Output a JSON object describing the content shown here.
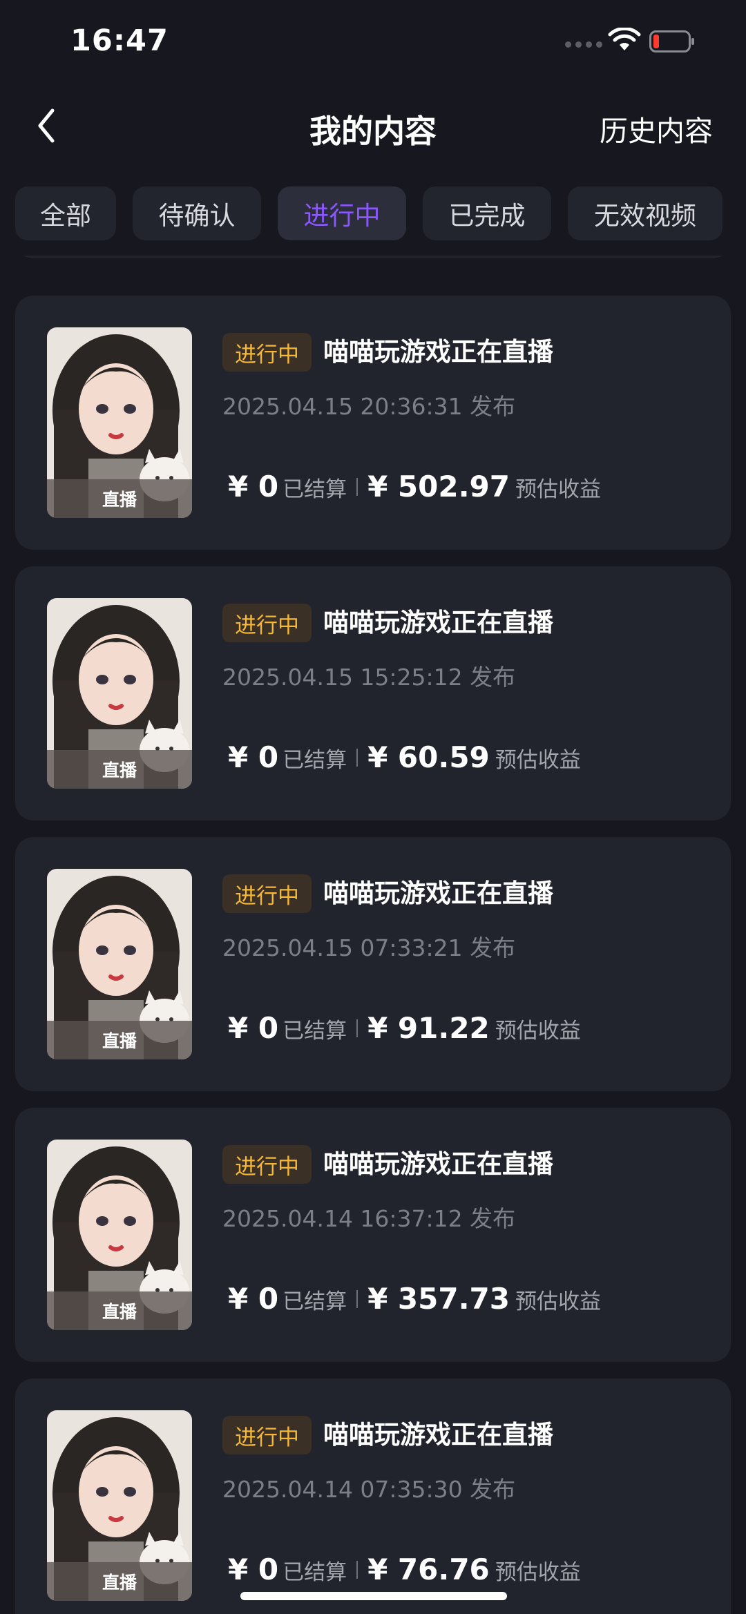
{
  "status_bar": {
    "time": "16:47"
  },
  "nav": {
    "title": "我的内容",
    "history": "历史内容"
  },
  "tabs": [
    {
      "label": "全部",
      "active": false
    },
    {
      "label": "待确认",
      "active": false
    },
    {
      "label": "进行中",
      "active": true
    },
    {
      "label": "已完成",
      "active": false
    },
    {
      "label": "无效视频",
      "active": false
    }
  ],
  "items": [
    {
      "badge": "进行中",
      "title": "喵喵玩游戏正在直播",
      "time": "2025.04.15 20:36:31 发布",
      "thumb_label": "直播",
      "settled": "¥ 0",
      "settled_label": "已结算",
      "estimated": "¥ 502.97",
      "estimated_label": "预估收益"
    },
    {
      "badge": "进行中",
      "title": "喵喵玩游戏正在直播",
      "time": "2025.04.15 15:25:12 发布",
      "thumb_label": "直播",
      "settled": "¥ 0",
      "settled_label": "已结算",
      "estimated": "¥ 60.59",
      "estimated_label": "预估收益"
    },
    {
      "badge": "进行中",
      "title": "喵喵玩游戏正在直播",
      "time": "2025.04.15 07:33:21 发布",
      "thumb_label": "直播",
      "settled": "¥ 0",
      "settled_label": "已结算",
      "estimated": "¥ 91.22",
      "estimated_label": "预估收益"
    },
    {
      "badge": "进行中",
      "title": "喵喵玩游戏正在直播",
      "time": "2025.04.14 16:37:12 发布",
      "thumb_label": "直播",
      "settled": "¥ 0",
      "settled_label": "已结算",
      "estimated": "¥ 357.73",
      "estimated_label": "预估收益"
    },
    {
      "badge": "进行中",
      "title": "喵喵玩游戏正在直播",
      "time": "2025.04.14 07:35:30 发布",
      "thumb_label": "直播",
      "settled": "¥ 0",
      "settled_label": "已结算",
      "estimated": "¥ 76.76",
      "estimated_label": "预估收益"
    }
  ],
  "colors": {
    "background": "#16171f",
    "card": "#21232d",
    "accent": "#8b57ff",
    "badge_text": "#f7b838",
    "badge_bg": "#3a3025"
  },
  "icons": [
    "back-arrow-icon",
    "wifi-icon",
    "battery-low-icon",
    "signal-dots-icon"
  ]
}
